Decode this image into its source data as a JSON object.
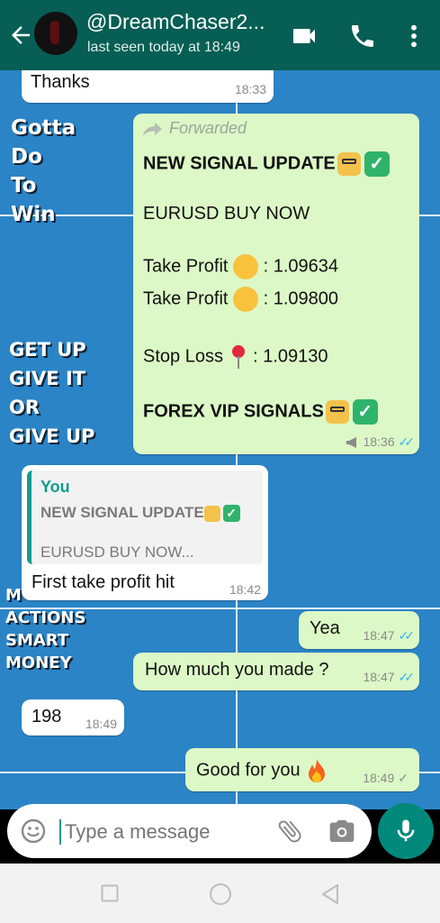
{
  "header": {
    "contact_name": "@DreamChaser2...",
    "last_seen": "last seen today at 18:49"
  },
  "icons": {
    "back": "back-arrow-icon",
    "video": "video-call-icon",
    "call": "phone-icon",
    "menu": "more-vert-icon",
    "emoji": "emoji-icon",
    "attach": "paperclip-icon",
    "camera": "camera-icon",
    "mic": "mic-icon"
  },
  "wallpaper": {
    "text_a": [
      "Gotta",
      "Do",
      "To",
      "Win"
    ],
    "text_b": [
      "GET UP",
      "GIVE IT",
      "OR",
      "GIVE UP"
    ],
    "text_c": [
      "M",
      "ACTIONS",
      "SMART",
      "MONEY"
    ]
  },
  "messages": {
    "m1": {
      "text": "Thanks",
      "time": "18:33"
    },
    "m2": {
      "forwarded": "Forwarded",
      "title": "NEW SIGNAL UPDATE",
      "pair": "EURUSD BUY NOW",
      "tp_label": "Take Profit",
      "tp1": ": 1.09634",
      "tp2": ": 1.09800",
      "sl_label": "Stop Loss",
      "sl": ": 1.09130",
      "footer": "FOREX VIP SIGNALS",
      "time": "18:36"
    },
    "m3": {
      "quote_author": "You",
      "quote_title": "NEW SIGNAL UPDATE",
      "quote_line": "EURUSD BUY NOW...",
      "text": "First take profit hit",
      "time": "18:42"
    },
    "m4": {
      "text": "Yea",
      "time": "18:47"
    },
    "m5": {
      "text": "How much you made ?",
      "time": "18:47"
    },
    "m6": {
      "text": "198",
      "time": "18:49"
    },
    "m7": {
      "text": "Good for you",
      "time": "18:49"
    }
  },
  "composer": {
    "placeholder": "Type a message"
  },
  "colors": {
    "header": "#075e54",
    "wallpaper": "#2b84c6",
    "outgoing": "#dcf8c6",
    "incoming": "#ffffff",
    "read_tick": "#34b7f1",
    "mic_button": "#00897b"
  }
}
